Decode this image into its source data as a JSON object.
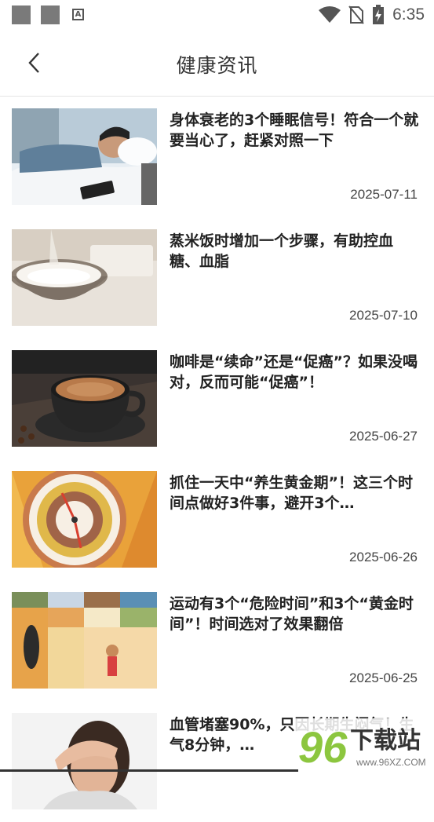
{
  "status_bar": {
    "time": "6:35",
    "notification_icons": [
      "square-icon",
      "square-icon",
      "a-icon"
    ],
    "system_icons": [
      "wifi-icon",
      "no-sim-icon",
      "battery-charging-icon"
    ]
  },
  "app_bar": {
    "title": "健康资讯",
    "back_icon": "chevron-left-icon"
  },
  "articles": [
    {
      "title": "身体衰老的3个睡眠信号！符合一个就要当心了，赶紧对照一下",
      "date": "2025-07-11",
      "thumb": "sleeping-man"
    },
    {
      "title": "蒸米饭时增加一个步骤，有助控血糖、血脂",
      "date": "2025-07-10",
      "thumb": "rice-bowl"
    },
    {
      "title": "咖啡是“续命”还是“促癌”？如果没喝对，反而可能“促癌”！",
      "date": "2025-06-27",
      "thumb": "coffee-cup"
    },
    {
      "title": "抓住一天中“养生黄金期”！这三个时间点做好3件事，避开3个…",
      "date": "2025-06-26",
      "thumb": "clock"
    },
    {
      "title": "运动有3个“危险时间”和3个“黄金时间”！时间选对了效果翻倍",
      "date": "2025-06-25",
      "thumb": "running-collage"
    },
    {
      "title": "血管堵塞90%，只因长期生闷气！生气8分钟，…",
      "date": "",
      "thumb": "headache-woman"
    }
  ],
  "watermark": {
    "number": "96",
    "text": "下载站",
    "url": "www.96XZ.COM"
  },
  "colors": {
    "accent_green": "#8cc63f",
    "title_text": "#222222",
    "date_text": "#444444"
  }
}
